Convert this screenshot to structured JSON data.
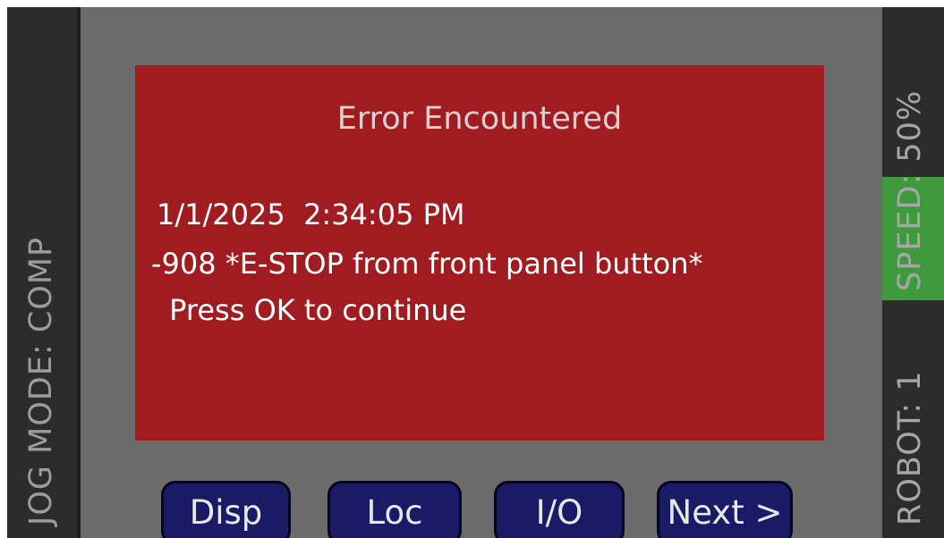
{
  "left_bar": {
    "label": "JOG MODE: COMP"
  },
  "right_bar": {
    "speed_label": "SPEED: 50%",
    "robot_label": "ROBOT: 1",
    "speed_highlight_color": "#3f9a3d"
  },
  "dialog": {
    "title": "Error Encountered",
    "timestamp": "1/1/2025  2:34:05 PM",
    "message": "-908 *E-STOP from front panel button*",
    "instruction": " Press OK to continue",
    "background_color": "#a01c20"
  },
  "buttons": {
    "disp": "Disp",
    "loc": "Loc",
    "io": "I/O",
    "next": "Next >"
  }
}
